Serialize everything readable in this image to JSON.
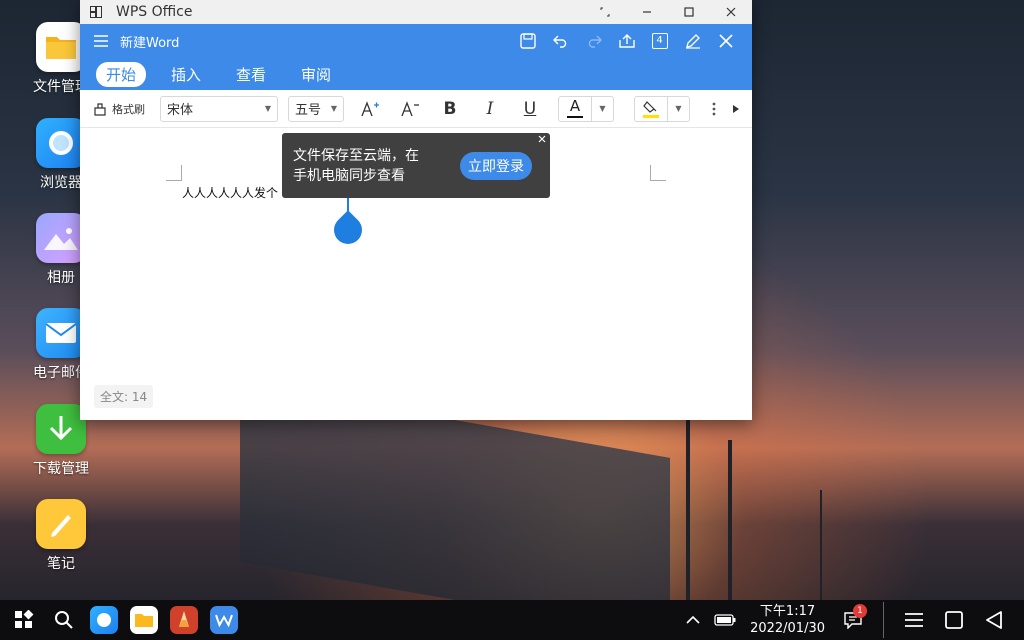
{
  "desktop": {
    "icons": [
      {
        "label": "文件管理"
      },
      {
        "label": "浏览器"
      },
      {
        "label": "相册"
      },
      {
        "label": "电子邮件"
      },
      {
        "label": "下载管理"
      },
      {
        "label": "笔记"
      }
    ]
  },
  "window": {
    "title": "WPS Office",
    "doc_name": "新建Word",
    "page_count_badge": "4",
    "tabs": [
      {
        "label": "开始",
        "active": true
      },
      {
        "label": "插入",
        "active": false
      },
      {
        "label": "查看",
        "active": false
      },
      {
        "label": "审阅",
        "active": false
      }
    ],
    "format": {
      "painter_label": "格式刷",
      "font_name": "宋体",
      "font_size": "五号",
      "bold": "B",
      "italic": "I",
      "underline": "U",
      "font_color_letter": "A"
    },
    "document": {
      "text": "人人人人人人发个",
      "word_count": "全文: 14"
    },
    "tooltip": {
      "message_line1": "文件保存至云端，在",
      "message_line2": "手机电脑同步查看",
      "login_button": "立即登录"
    }
  },
  "taskbar": {
    "time": "下午1:17",
    "date": "2022/01/30",
    "notification_count": "1"
  },
  "colors": {
    "accent": "#3d8ae8",
    "tooltip_bg": "#404040"
  }
}
